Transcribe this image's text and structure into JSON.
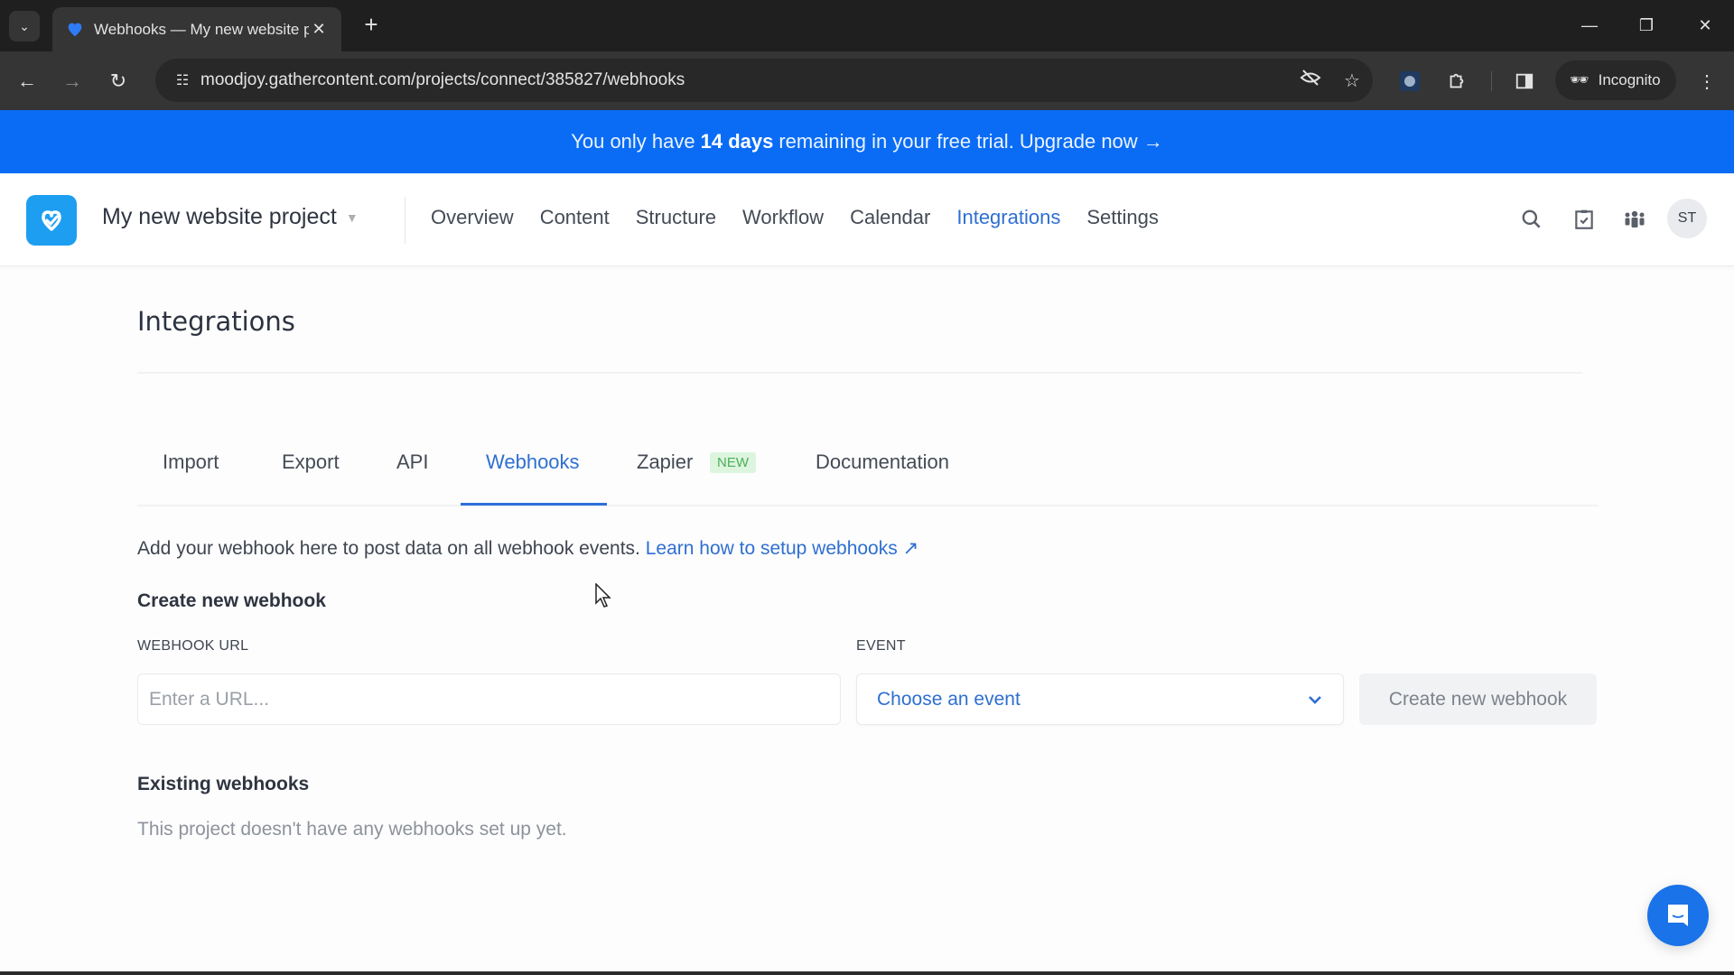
{
  "browser": {
    "tab_title": "Webhooks — My new website project",
    "url": "moodjoy.gathercontent.com/projects/connect/385827/webhooks",
    "incognito_label": "Incognito",
    "icons": [
      "tab-search-icon",
      "close-tab-icon",
      "new-tab-icon",
      "minimize-icon",
      "restore-icon",
      "close-window-icon",
      "back-icon",
      "forward-icon",
      "reload-icon",
      "site-settings-icon",
      "eye-slash-icon",
      "star-icon",
      "extension-avatar-icon",
      "extensions-puzzle-icon",
      "side-panel-icon",
      "incognito-icon",
      "menu-kebab-icon"
    ]
  },
  "banner": {
    "prefix": "You only have",
    "highlight": "14 days",
    "suffix": "remaining in your free trial.",
    "link": "Upgrade now →",
    "color": "#0a6cf5"
  },
  "header": {
    "project_name": "My new website project",
    "nav": [
      {
        "label": "Overview",
        "active": false
      },
      {
        "label": "Content",
        "active": false
      },
      {
        "label": "Structure",
        "active": false
      },
      {
        "label": "Workflow",
        "active": false
      },
      {
        "label": "Calendar",
        "active": false
      },
      {
        "label": "Integrations",
        "active": true
      },
      {
        "label": "Settings",
        "active": false
      }
    ],
    "avatar_initials": "ST",
    "accent": "#2f6fd1"
  },
  "page": {
    "title": "Integrations",
    "tabs": [
      {
        "label": "Import",
        "active": false
      },
      {
        "label": "Export",
        "active": false
      },
      {
        "label": "API",
        "active": false
      },
      {
        "label": "Webhooks",
        "active": true
      },
      {
        "label": "Zapier",
        "active": false,
        "badge": "NEW"
      },
      {
        "label": "Documentation",
        "active": false
      }
    ],
    "description": "Add your webhook here to post data on all webhook events.",
    "learn_link": "Learn how to setup webhooks ↗",
    "create_heading": "Create new webhook",
    "url_label": "WEBHOOK URL",
    "url_placeholder": "Enter a URL...",
    "url_value": "",
    "event_label": "EVENT",
    "event_value": "Choose an event",
    "create_button": "Create new webhook",
    "existing_heading": "Existing webhooks",
    "empty_message": "This project doesn't have any webhooks set up yet."
  }
}
